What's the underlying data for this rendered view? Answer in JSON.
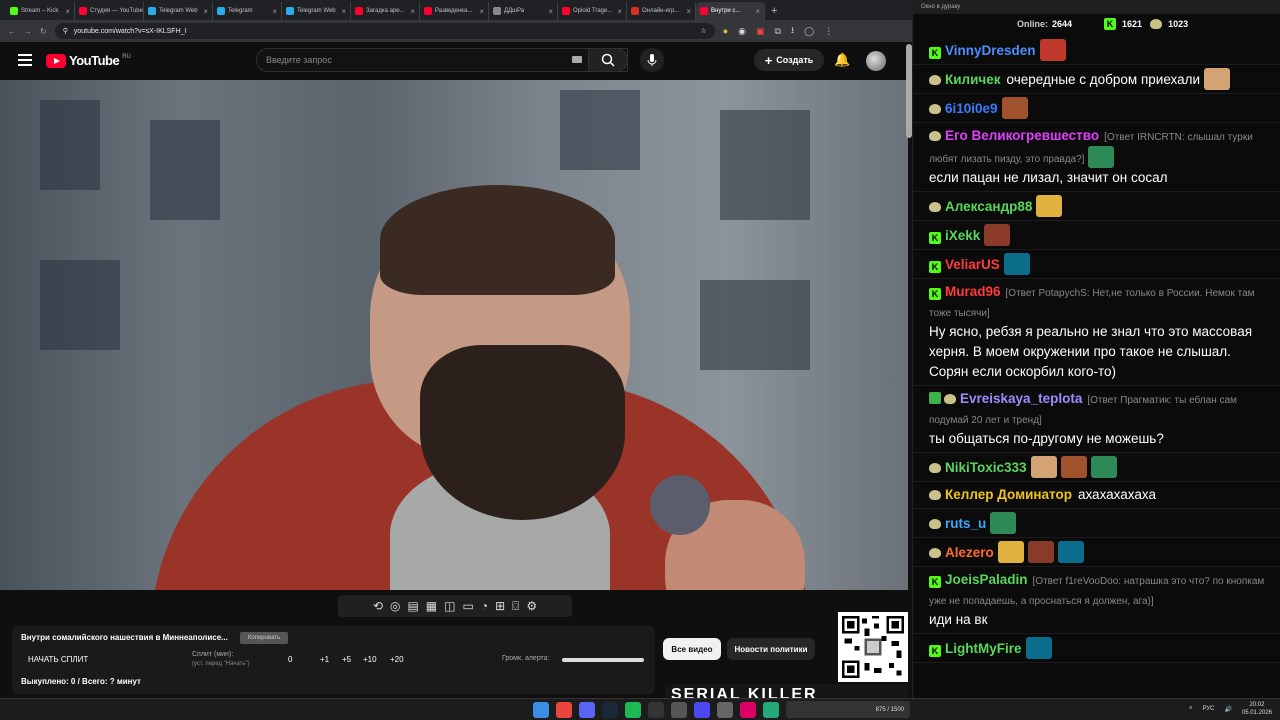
{
  "browser": {
    "tabs": [
      {
        "label": "Stream – Kick",
        "color": "#53fc18"
      },
      {
        "label": "Студия — YouTube",
        "color": "#ff0033"
      },
      {
        "label": "Telegram Web",
        "color": "#2aabee"
      },
      {
        "label": "Telegram",
        "color": "#2aabee"
      },
      {
        "label": "Telegram Web",
        "color": "#2aabee"
      },
      {
        "label": "Загадка аре...",
        "color": "#ff0033"
      },
      {
        "label": "Разведенка...",
        "color": "#ff0033"
      },
      {
        "label": "ДДшРа",
        "color": "#888888"
      },
      {
        "label": "Opioid Trage...",
        "color": "#ff0033"
      },
      {
        "label": "Онлайн-игр...",
        "color": "#d93025"
      },
      {
        "label": "Внутри с...",
        "color": "#ff0033"
      }
    ],
    "url": "youtube.com/watch?v=sX-IKLSFH_I"
  },
  "youtube": {
    "logo_text": "YouTube",
    "region": "RU",
    "search_placeholder": "Введите запрос",
    "create_label": "Создать"
  },
  "panel": {
    "video_title": "Внутри сомалийского нашествия в Миннеаполисе...",
    "copy_button": "Копировать",
    "start_split": "НАЧАТЬ СПЛИТ",
    "split_label": "Сплит (мин):",
    "split_hint": "(уст. перед \"Начать\")",
    "split_value": "0",
    "increments": [
      "+1",
      "+5",
      "+10",
      "+20"
    ],
    "alert_volume_label": "Громк. алерта:",
    "alert_volume": 1.0,
    "bought": "Выкуплено: 0 / Всего: ? минут"
  },
  "chips": {
    "all_videos": "Все видео",
    "policy_news": "Новости политики"
  },
  "thumbnail_text": "SERIAL KILLER",
  "chat": {
    "window_title": "Окно в дураку",
    "online_label": "Online:",
    "online_count": "2644",
    "kick_count": "1621",
    "other_count": "1023",
    "messages": [
      {
        "badge": "K",
        "user": "VinnyDresden",
        "color": "#4f8cff",
        "text": "",
        "reply": "",
        "emotes": 1
      },
      {
        "badge": "E",
        "user": "Киличек",
        "color": "#59d65c",
        "text": "очередные с добром приехали",
        "reply": "",
        "emotes": 1
      },
      {
        "badge": "E",
        "user": "6i10i0e9",
        "color": "#3a7bff",
        "text": "",
        "reply": "",
        "emotes": 1
      },
      {
        "badge": "E",
        "user": "Его Великогревшество",
        "color": "#e040fb",
        "text": "если пацан не лизал, значит он сосал",
        "reply": "[Ответ IRNCRTN: слышал турки любят лизать пизду, это правда?]",
        "emotes": 1
      },
      {
        "badge": "E",
        "user": "Александр88",
        "color": "#59d65c",
        "text": "",
        "reply": "",
        "emotes": 1
      },
      {
        "badge": "K",
        "user": "iXekk",
        "color": "#59d65c",
        "text": "",
        "reply": "",
        "emotes": 1
      },
      {
        "badge": "K",
        "user": "VeliarUS",
        "color": "#ff3b3b",
        "text": "",
        "reply": "",
        "emotes": 1
      },
      {
        "badge": "K",
        "user": "Murad96",
        "color": "#ff3b3b",
        "text": "Ну ясно, ребзя я реально не знал что это массовая херня. В моем окружении про такое не слышал. Сорян если оскорбил кого-то)",
        "reply": "[Ответ PotapychS: Нет,не только в России. Немок там тоже тысячи]",
        "emotes": 0
      },
      {
        "badge": "PE",
        "user": "Evreiskaya_teplota",
        "color": "#9b8cff",
        "text": "ты общаться по-другому не можешь?",
        "reply": "[Ответ Прагматик: ты еблан сам подумай 20 лет и тренд]",
        "emotes": 0
      },
      {
        "badge": "E",
        "user": "NikiToxic333",
        "color": "#59d65c",
        "text": "",
        "reply": "",
        "emotes": 3
      },
      {
        "badge": "E",
        "user": "Келлер Доминатор",
        "color": "#f0c419",
        "text": "ахахахахаха",
        "reply": "",
        "emotes": 0
      },
      {
        "badge": "E",
        "user": "ruts_u",
        "color": "#3aa8ff",
        "text": "",
        "reply": "",
        "emotes": 1
      },
      {
        "badge": "E",
        "user": "Alezero",
        "color": "#ff6a2b",
        "text": "",
        "reply": "",
        "emotes": 3
      },
      {
        "badge": "K",
        "user": "JoeisPaladin",
        "color": "#59d65c",
        "text": "иди на вк",
        "reply": "[Ответ f1reVooDoo: натрашка это что? по кнопкам уже не попадаешь, а проснаться я должен, ага)]",
        "emotes": 0
      },
      {
        "badge": "K",
        "user": "LightMyFire",
        "color": "#59d65c",
        "text": "",
        "reply": "",
        "emotes": 1
      }
    ]
  },
  "taskbar": {
    "lang": "РУС",
    "time": "20:02",
    "date": "05.01.2026",
    "widget_text": "875 / 1500"
  }
}
